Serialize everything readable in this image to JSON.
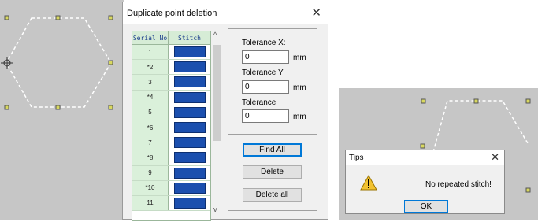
{
  "dialog": {
    "title": "Duplicate point deletion",
    "close_glyph": "✕",
    "table": {
      "headers": [
        "Serial No",
        "Stitch"
      ],
      "rows": [
        "1",
        "*2",
        "3",
        "*4",
        "5",
        "*6",
        "7",
        "*8",
        "9",
        "*10",
        "11"
      ],
      "stitch_color": "#1b4fae"
    },
    "scroll_up_glyph": "^",
    "scroll_down_glyph": "v",
    "tolerance_x": {
      "label": "Tolerance X:",
      "value": "0",
      "unit": "mm"
    },
    "tolerance_y": {
      "label": "Tolerance Y:",
      "value": "0",
      "unit": "mm"
    },
    "tolerance": {
      "label": "Tolerance",
      "value": "0",
      "unit": "mm"
    },
    "buttons": {
      "find_all": "Find All",
      "delete": "Delete",
      "delete_all": "Delete all"
    }
  },
  "tips": {
    "title": "Tips",
    "close_glyph": "✕",
    "message": "No repeated stitch!",
    "ok": "OK",
    "icon": "warning-icon"
  },
  "canvas": {
    "background": "#c6c6c6",
    "point_color": "#c8c84a",
    "outline_color": "#ffffff",
    "icon": "crosshair-icon"
  }
}
